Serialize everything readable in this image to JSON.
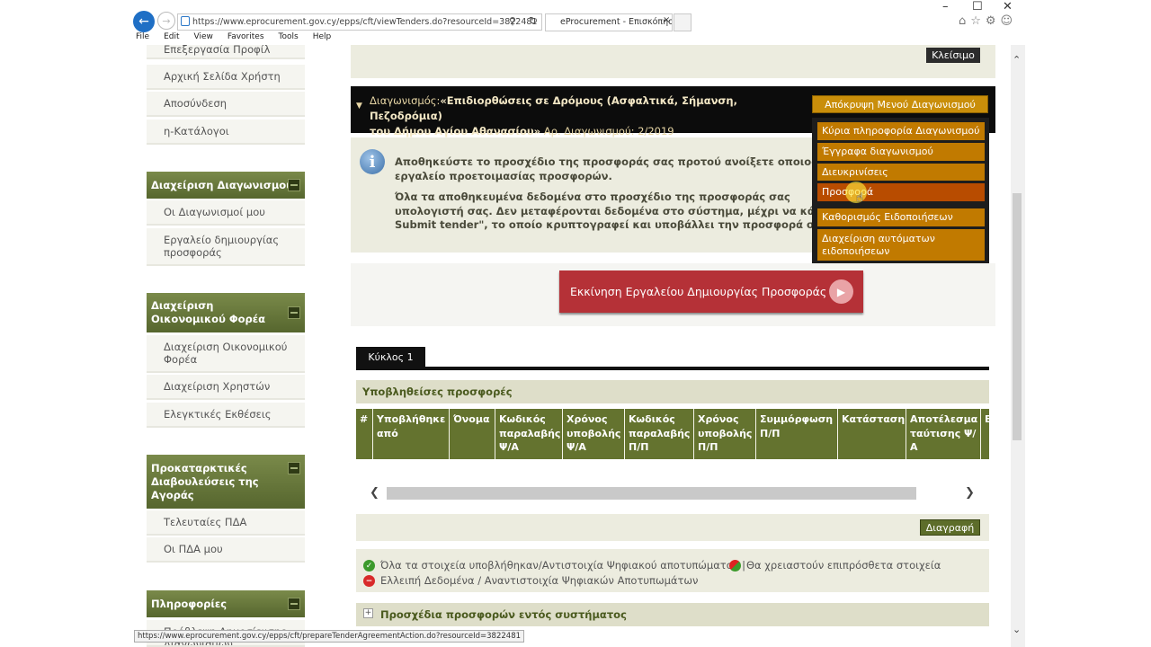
{
  "browser": {
    "url": "https://www.eprocurement.gov.cy/epps/cft/viewTenders.do?resourceId=3822481",
    "tab_title": "eProcurement - Επισκόπησ...",
    "tab_close": "×",
    "menu": [
      "File",
      "Edit",
      "View",
      "Favorites",
      "Tools",
      "Help"
    ],
    "window_controls": [
      "–",
      "☐",
      "✕"
    ],
    "status_url": "https://www.eprocurement.gov.cy/epps/cft/prepareTenderAgreementAction.do?resourceId=3822481"
  },
  "sidebar": {
    "profile_items": [
      "Επεξεργασία Προφίλ",
      "Αρχική Σελίδα Χρήστη",
      "Αποσύνδεση",
      "η-Κατάλογοι"
    ],
    "sections": [
      {
        "title": "Διαχείριση Διαγωνισμού",
        "items": [
          "Οι Διαγωνισμοί μου",
          "Εργαλείο δημιουργίας προσφοράς"
        ]
      },
      {
        "title": "Διαχείριση Οικονομικού Φορέα",
        "items": [
          "Διαχείριση Οικονομικού Φορέα",
          "Διαχείριση Χρηστών",
          "Ελεγκτικές Εκθέσεις"
        ]
      },
      {
        "title": "Προκαταρκτικές Διαβουλεύσεις της Αγοράς",
        "items": [
          "Τελευταίες ΠΔΑ",
          "Οι ΠΔΑ μου"
        ]
      },
      {
        "title": "Πληροφορίες",
        "items": [
          "Πρόβλεψη Δημοσίευσης Διαγωνισμών"
        ]
      }
    ]
  },
  "header": {
    "close_button": "Κλείσιμο"
  },
  "tender": {
    "label": "Διαγωνισμός:",
    "title": "«Επιδιορθώσεις σε Δρόμους (Ασφαλτικά, Σήμανση, Πεζοδρόμια) του Δήμου Αγίου Αθανασίου» Αρ. Διαγωνισμού: 2/2019",
    "title_line1": "«Επιδιορθώσεις σε Δρόμους (Ασφαλτικά, Σήμανση, Πεζοδρόμια)",
    "title_line2_bold": "του Δήμου Αγίου Αθανασίου»",
    "title_line2_rest": " Αρ. Διαγωνισμού: 2/2019",
    "hide_menu_button": "Απόκρυψη Μενού Διαγωνισμού"
  },
  "tender_menu": {
    "items": [
      "Κύρια πληροφορία Διαγωνισμού",
      "Έγγραφα διαγωνισμού",
      "Διευκρινίσεις",
      "Προσφορά",
      "Καθορισμός Ειδοποιήσεων",
      "Διαχείριση αυτόματων ειδοποιήσεων"
    ],
    "active_index": 3
  },
  "info": {
    "line1": "Αποθηκεύστε το προσχέδιο της προσφοράς σας προτού ανοίξετε οποιοδήποτε",
    "line2": "εργαλείο προετοιμασίας προσφορών.",
    "line3": "Όλα τα αποθηκευμένα δεδομένα στο προσχέδιο της προσφοράς σας",
    "line4": "υπολογιστή σας. Δεν μεταφέρονται δεδομένα στο σύστημα, μέχρι να κάνετε",
    "line5": "Submit tender\", το οποίο κρυπτογραφεί και υποβάλλει την προσφορά σας."
  },
  "launch_button": "Εκκίνηση Εργαλείου Δημιουργίας Προσφοράς",
  "round_tab": "Κύκλος 1",
  "submitted": {
    "title": "Υποβληθείσες προσφορές",
    "columns": [
      "#",
      "Υποβλήθηκε από",
      "Όνομα",
      "Κωδικός παραλαβής Ψ/Α",
      "Χρόνος υποβολής Ψ/Α",
      "Κωδικός παραλαβής Π/Π",
      "Χρόνος υποβολής Π/Π",
      "Συμμόρφωση Π/Π",
      "Κατάσταση",
      "Αποτέλεσμα ταύτισης Ψ/Α",
      "Εμ"
    ]
  },
  "delete_button": "Διαγραφή",
  "legend": {
    "complete": "Όλα τα στοιχεία υποβλήθηκαν/Αντιστοιχία Ψηφιακού αποτυπώματος |",
    "more_needed": "Θα χρειαστούν επιπρόσθετα στοιχεία",
    "missing": "Ελλειπή Δεδομένα / Αναντιστοιχία Ψηφιακών Αποτυπωμάτων"
  },
  "drafts_title": "Προσχέδια προσφορών εντός συστήματος",
  "colors": {
    "sidebar_header": "#5f6f32",
    "tender_bar": "#0c0c0c",
    "menu_item": "#c17a00",
    "launch_button": "#b53137",
    "table_header": "#64732f"
  }
}
